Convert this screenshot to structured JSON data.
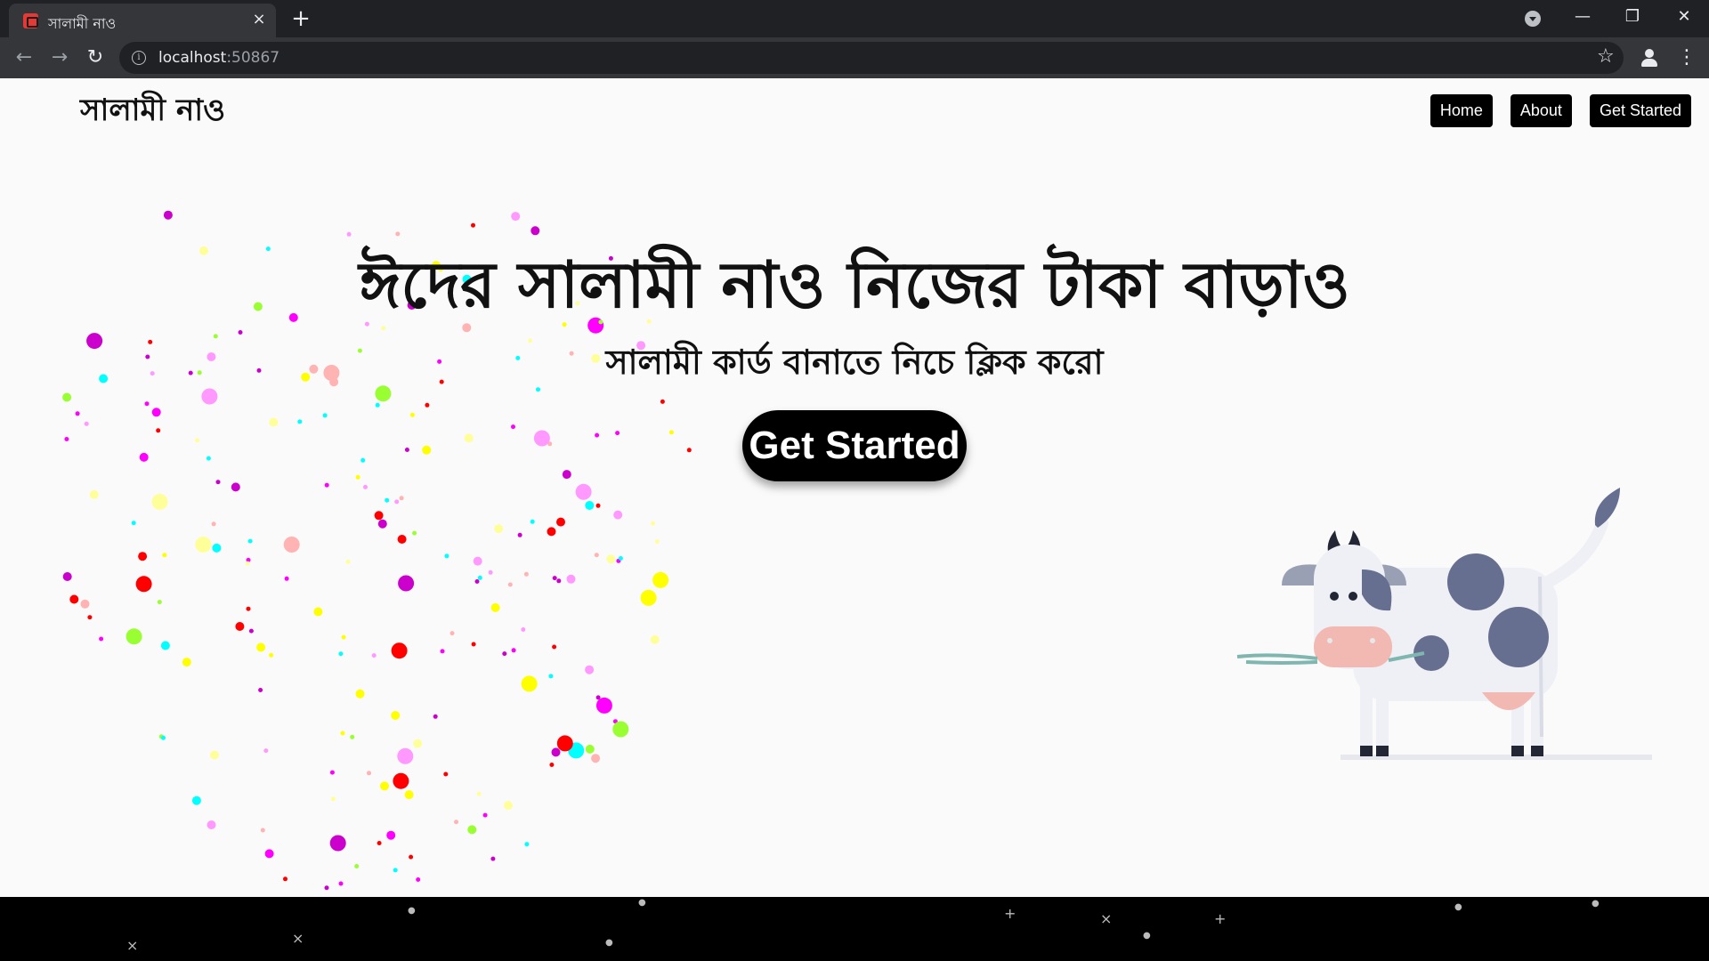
{
  "browser": {
    "tab_title": "সালামী নাও",
    "tab_close": "×",
    "new_tab": "+",
    "url_host": "localhost",
    "url_port": ":50867",
    "win_min": "—",
    "win_max": "❐",
    "win_close": "✕"
  },
  "site": {
    "brand": "সালামী নাও",
    "nav": [
      {
        "label": "Home"
      },
      {
        "label": "About"
      },
      {
        "label": "Get Started"
      }
    ],
    "hero": {
      "title": "ঈদের সালামী নাও নিজের টাকা বাড়াও",
      "subtitle": "সালামী কার্ড বানাতে নিচে ক্লিক করো",
      "cta": "Get Started"
    }
  },
  "colors": {
    "confetti": [
      "#ff0000",
      "#ffff00",
      "#00ffff",
      "#ff00ff",
      "#ffb3b3",
      "#ff99ff",
      "#ffff99",
      "#99ff33",
      "#cc00cc"
    ],
    "cow_spot": "#666f8f",
    "cow_body": "#eef0f5",
    "cow_nose": "#f2b8b2",
    "footer": "#000000"
  }
}
